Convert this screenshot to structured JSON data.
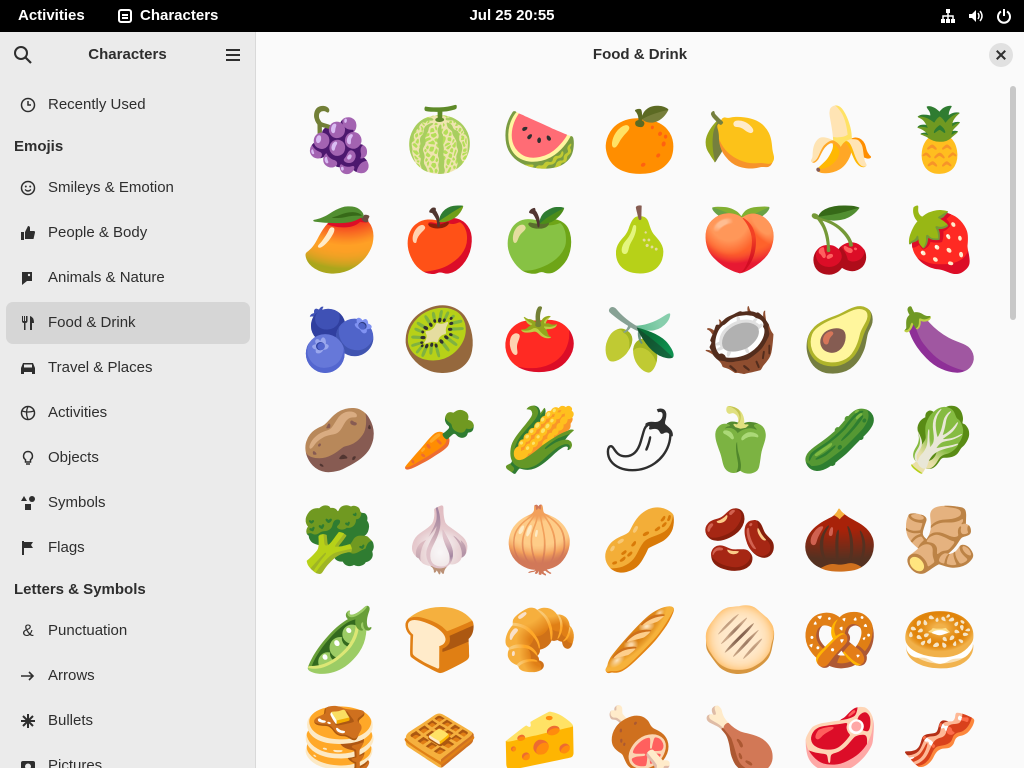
{
  "topbar": {
    "activities": "Activities",
    "app_name": "Characters",
    "clock": "Jul 25  20:55"
  },
  "sidebar": {
    "title": "Characters",
    "items": [
      {
        "label": "Recently Used",
        "icon": "clock-icon",
        "top": 0
      },
      {
        "label": "Smileys & Emotion",
        "icon": "smiley-icon"
      },
      {
        "label": "People & Body",
        "icon": "thumbs-up-icon"
      },
      {
        "label": "Animals & Nature",
        "icon": "animal-icon"
      },
      {
        "label": "Food & Drink",
        "icon": "fork-knife-icon",
        "active": true
      },
      {
        "label": "Travel & Places",
        "icon": "car-icon"
      },
      {
        "label": "Activities",
        "icon": "activities-icon"
      },
      {
        "label": "Objects",
        "icon": "lightbulb-icon"
      },
      {
        "label": "Symbols",
        "icon": "symbols-icon"
      },
      {
        "label": "Flags",
        "icon": "flag-icon"
      },
      {
        "label": "Punctuation",
        "icon": "ampersand-icon"
      },
      {
        "label": "Arrows",
        "icon": "arrow-right-icon"
      },
      {
        "label": "Bullets",
        "icon": "bullet-icon"
      },
      {
        "label": "Pictures",
        "icon": "pictures-icon"
      }
    ],
    "sections": {
      "emojis": "Emojis",
      "letters": "Letters & Symbols"
    }
  },
  "main": {
    "title": "Food & Drink",
    "emojis": [
      "🍇",
      "🍈",
      "🍉",
      "🍊",
      "🍋",
      "🍌",
      "🍍",
      "🥭",
      "🍎",
      "🍏",
      "🍐",
      "🍑",
      "🍒",
      "🍓",
      "🫐",
      "🥝",
      "🍅",
      "🫒",
      "🥥",
      "🥑",
      "🍆",
      "🥔",
      "🥕",
      "🌽",
      "🌶",
      "🫑",
      "🥒",
      "🥬",
      "🥦",
      "🧄",
      "🧅",
      "🥜",
      "🫘",
      "🌰",
      "🫚",
      "🫛",
      "🍞",
      "🥐",
      "🥖",
      "🫓",
      "🥨",
      "🥯",
      "🥞",
      "🧇",
      "🧀",
      "🍖",
      "🍗",
      "🥩",
      "🥓"
    ]
  }
}
